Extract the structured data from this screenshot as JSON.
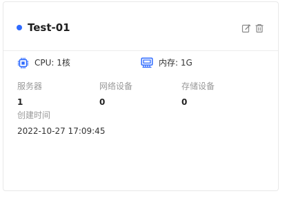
{
  "card": {
    "title": "Test-01",
    "status_color": "#2f6bff",
    "actions": {
      "edit_icon": "edit-icon",
      "delete_icon": "trash-icon"
    },
    "specs": {
      "cpu_icon": "cpu-chip-icon",
      "cpu_text": "CPU: 1核",
      "memory_icon": "memory-icon",
      "memory_text": "内存: 1G",
      "icon_color": "#2f6bff"
    },
    "stats": [
      {
        "label": "服务器",
        "value": "1"
      },
      {
        "label": "网络设备",
        "value": "0"
      },
      {
        "label": "存储设备",
        "value": "0"
      }
    ],
    "created": {
      "label": "创建时间",
      "value": "2022-10-27 17:09:45"
    }
  }
}
